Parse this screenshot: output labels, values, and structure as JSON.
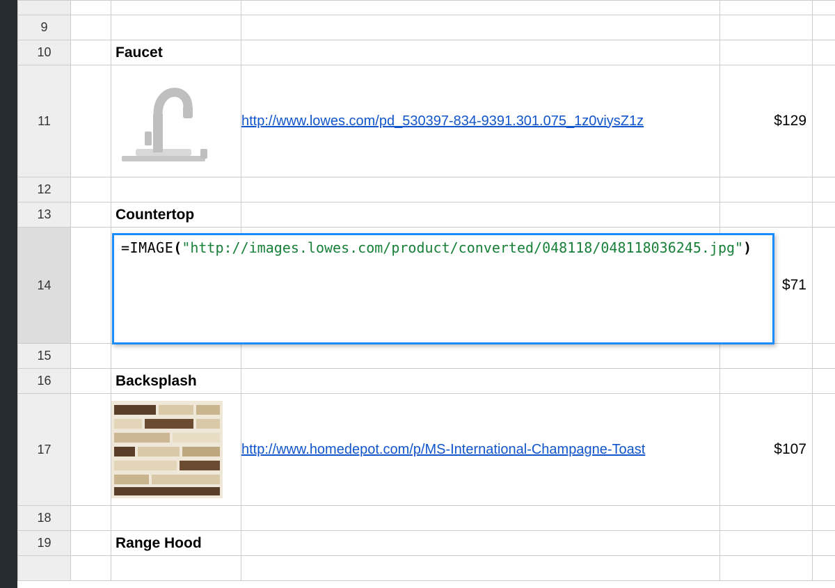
{
  "rows": {
    "r9": {
      "num": "9"
    },
    "r10": {
      "num": "10",
      "label": "Faucet"
    },
    "r11": {
      "num": "11",
      "url": "http://www.lowes.com/pd_530397-834-9391.301.075_1z0viysZ1z",
      "price": "$129"
    },
    "r12": {
      "num": "12"
    },
    "r13": {
      "num": "13",
      "label": "Countertop"
    },
    "r14": {
      "num": "14",
      "price": "$71"
    },
    "r15": {
      "num": "15"
    },
    "r16": {
      "num": "16",
      "label": "Backsplash"
    },
    "r17": {
      "num": "17",
      "url": "http://www.homedepot.com/p/MS-International-Champagne-Toast",
      "price": "$107"
    },
    "r18": {
      "num": "18"
    },
    "r19": {
      "num": "19",
      "label": "Range Hood"
    }
  },
  "formula": {
    "eq": "=",
    "fn": "IMAGE",
    "open": "(",
    "str": "\"http://images.lowes.com/product/converted/048118/048118036245.jpg\"",
    "close": ")"
  }
}
